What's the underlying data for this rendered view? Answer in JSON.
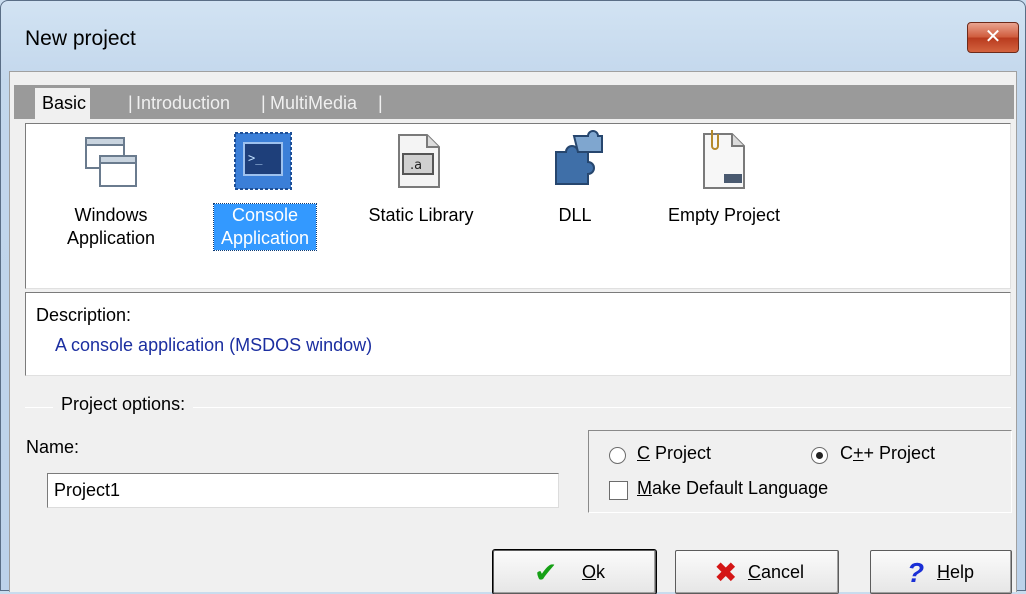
{
  "window": {
    "title": "New project",
    "close_label": "✕"
  },
  "tabs": [
    {
      "label": "Basic",
      "active": true
    },
    {
      "label": "Introduction",
      "active": false
    },
    {
      "label": "MultiMedia",
      "active": false
    }
  ],
  "tab_separator": "|",
  "templates": [
    {
      "line1": "Windows",
      "line2": "Application",
      "icon": "windows-application-icon",
      "selected": false
    },
    {
      "line1": "Console",
      "line2": "Application",
      "icon": "console-application-icon",
      "selected": true
    },
    {
      "line1": "Static Library",
      "line2": "",
      "icon": "static-library-icon",
      "selected": false
    },
    {
      "line1": "DLL",
      "line2": "",
      "icon": "dll-puzzle-icon",
      "selected": false
    },
    {
      "line1": "Empty Project",
      "line2": "",
      "icon": "empty-project-icon",
      "selected": false
    }
  ],
  "description": {
    "label": "Description:",
    "text": "A console application (MSDOS window)"
  },
  "options": {
    "group_title": "Project options:",
    "name_label": "Name:",
    "name_value": "Project1",
    "c_project_label": "C Project",
    "cpp_project_label": "C++ Project",
    "language": "C++ Project",
    "make_default_label": "Make Default Language",
    "make_default_checked": false
  },
  "buttons": {
    "ok": "Ok",
    "cancel": "Cancel",
    "help": "Help"
  },
  "colors": {
    "selection": "#3399ff",
    "description_text": "#1b2ea0",
    "ok_check": "#16a016",
    "cancel_x": "#d41616",
    "help_q": "#1a2fd6"
  }
}
